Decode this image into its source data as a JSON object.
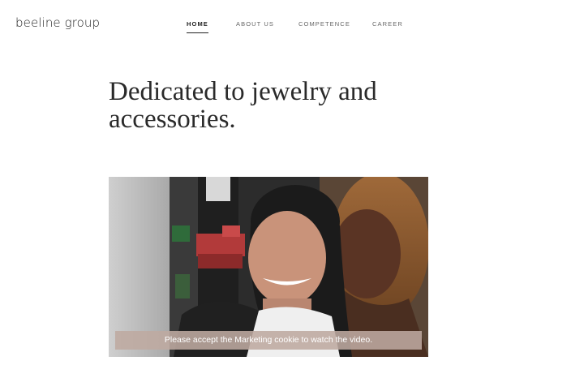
{
  "header": {
    "logo": "beeline group",
    "nav": [
      {
        "label": "HOME",
        "active": true
      },
      {
        "label": "ABOUT US",
        "active": false
      },
      {
        "label": "COMPETENCE",
        "active": false
      },
      {
        "label": "CAREER",
        "active": false
      }
    ]
  },
  "hero": {
    "headline": "Dedicated to jewelry and accessories."
  },
  "video": {
    "consent_message": "Please accept the Marketing cookie to watch the video."
  },
  "colors": {
    "text": "#222222",
    "consent_overlay": "#bfa99f"
  }
}
